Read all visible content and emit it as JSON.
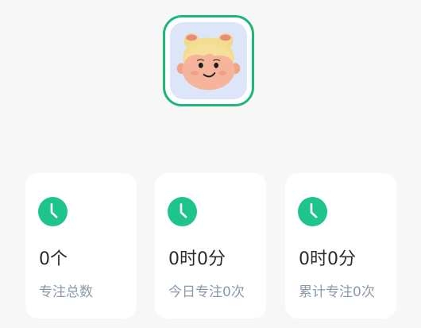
{
  "avatar": {
    "icon": "cartoon-girl-avatar",
    "border_color": "#1fb67a",
    "background_color": "#dde6f9"
  },
  "stats": [
    {
      "icon": "clock-icon",
      "value": "0个",
      "label": "专注总数"
    },
    {
      "icon": "clock-icon",
      "value": "0时0分",
      "label": "今日专注0次"
    },
    {
      "icon": "clock-icon",
      "value": "0时0分",
      "label": "累计专注0次"
    }
  ],
  "colors": {
    "accent": "#1fc38d",
    "label": "#8b98aa",
    "value": "#2b2b2b",
    "page_background": "#f7f7f8"
  }
}
